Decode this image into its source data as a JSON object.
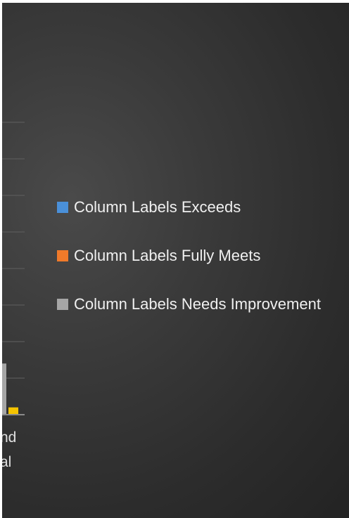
{
  "chart_data": {
    "type": "bar",
    "categories": [
      "…nd\n…al"
    ],
    "series": [
      {
        "name": "Column Labels Exceeds",
        "color": "#4a90d9",
        "values": [
          null
        ]
      },
      {
        "name": "Column Labels Fully Meets",
        "color": "#f07a2a",
        "values": [
          null
        ]
      },
      {
        "name": "Column Labels Needs Improvement",
        "color": "#a6a6a6",
        "values": [
          14
        ]
      },
      {
        "name": "",
        "color": "#f5c400",
        "values": [
          2
        ]
      }
    ],
    "ylim": [
      0,
      80
    ],
    "grid": true,
    "legend_position": "right"
  },
  "xaxis": {
    "category_lines": [
      "nd",
      "al"
    ]
  },
  "legend": {
    "items": [
      {
        "label": "Column Labels Exceeds",
        "color": "#4a90d9"
      },
      {
        "label": "Column Labels Fully Meets",
        "color": "#f07a2a"
      },
      {
        "label": "Column Labels Needs Improvement",
        "color": "#a6a6a6"
      }
    ]
  }
}
